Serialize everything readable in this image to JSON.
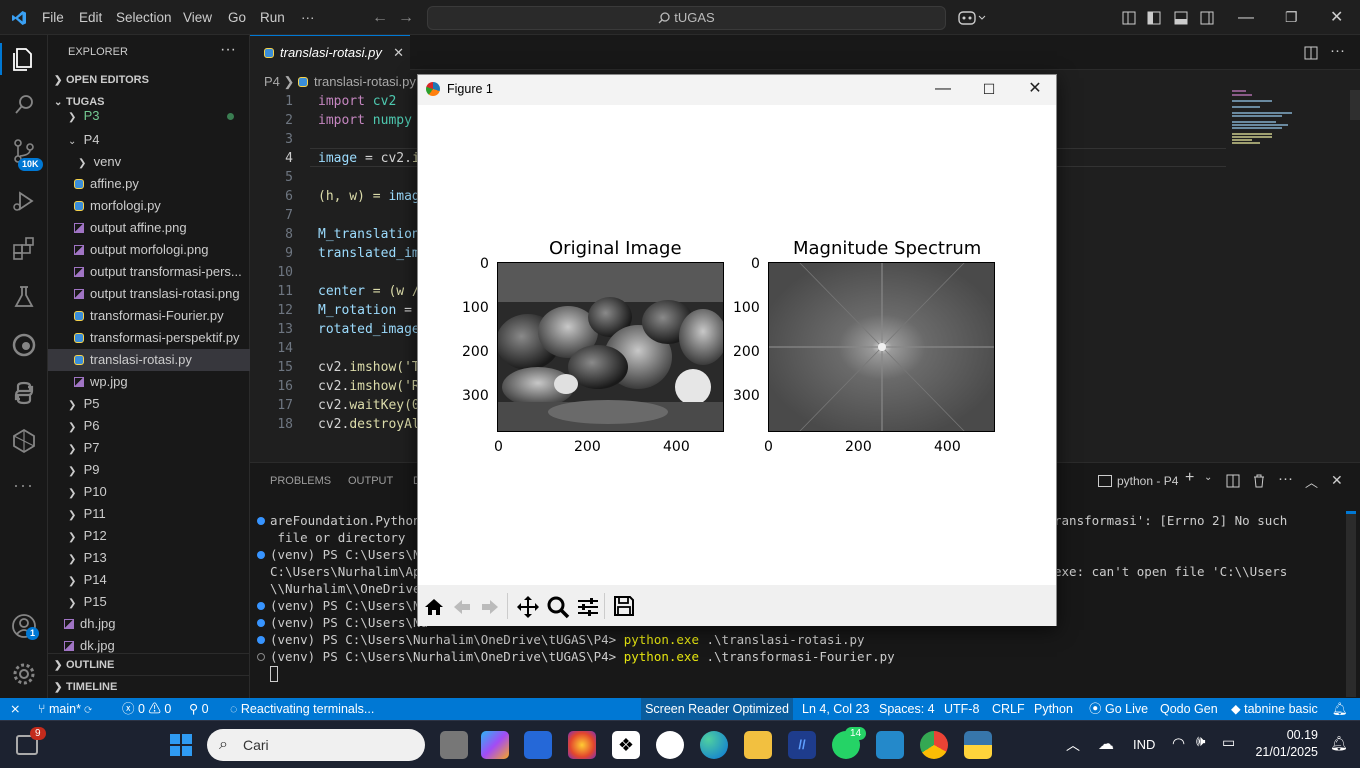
{
  "titlebar": {
    "menu": [
      "File",
      "Edit",
      "Selection",
      "View",
      "Go",
      "Run",
      "···"
    ],
    "search": "tUGAS"
  },
  "activity": {
    "source_control_badge": "10K",
    "accounts_badge": "1"
  },
  "sidebar": {
    "title": "EXPLORER",
    "open_editors": "OPEN EDITORS",
    "root": "TUGAS",
    "items": [
      {
        "label": "P3",
        "type": "folder"
      },
      {
        "label": "P4",
        "type": "folder-open"
      },
      {
        "label": "venv",
        "type": "folder"
      },
      {
        "label": "affine.py",
        "type": "py"
      },
      {
        "label": "morfologi.py",
        "type": "py"
      },
      {
        "label": "output affine.png",
        "type": "img"
      },
      {
        "label": "output morfologi.png",
        "type": "img"
      },
      {
        "label": "output transformasi-pers...",
        "type": "img"
      },
      {
        "label": "output translasi-rotasi.png",
        "type": "img"
      },
      {
        "label": "transformasi-Fourier.py",
        "type": "py"
      },
      {
        "label": "transformasi-perspektif.py",
        "type": "py"
      },
      {
        "label": "translasi-rotasi.py",
        "type": "py"
      },
      {
        "label": "wp.jpg",
        "type": "img"
      },
      {
        "label": "P5",
        "type": "folder"
      },
      {
        "label": "P6",
        "type": "folder"
      },
      {
        "label": "P7",
        "type": "folder"
      },
      {
        "label": "P9",
        "type": "folder"
      },
      {
        "label": "P10",
        "type": "folder"
      },
      {
        "label": "P11",
        "type": "folder"
      },
      {
        "label": "P12",
        "type": "folder"
      },
      {
        "label": "P13",
        "type": "folder"
      },
      {
        "label": "P14",
        "type": "folder"
      },
      {
        "label": "P15",
        "type": "folder"
      },
      {
        "label": "dh.jpg",
        "type": "img"
      },
      {
        "label": "dk.jpg",
        "type": "img"
      }
    ],
    "outline": "OUTLINE",
    "timeline": "TIMELINE"
  },
  "editor": {
    "tab": "translasi-rotasi.py",
    "breadcrumb_folder": "P4",
    "breadcrumb_file": "translasi-rotasi.py",
    "lines": [
      "1",
      "2",
      "3",
      "4",
      "5",
      "6",
      "7",
      "8",
      "9",
      "10",
      "11",
      "12",
      "13",
      "14",
      "15",
      "16",
      "17",
      "18"
    ],
    "code": {
      "l1a": "import",
      "l1b": " cv2",
      "l2a": "import",
      "l2b": " numpy",
      "l4a": "image",
      "l4b": " = cv2.",
      "l4c": "i",
      "l6a": "(h, w) = ",
      "l6b": "imag",
      "l8": "M_translation",
      "l9": "translated_im",
      "l11a": "center",
      "l11b": " = (w /",
      "l12a": "M_rotation",
      "l12b": " =",
      "l13": "rotated_image",
      "l15a": "cv2.",
      "l15b": "imshow",
      "l15c": "('T",
      "l16a": "cv2.",
      "l16b": "imshow",
      "l16c": "('R",
      "l17a": "cv2.",
      "l17b": "waitKey",
      "l17c": "(0",
      "l18a": "cv2.",
      "l18b": "destroyAl"
    }
  },
  "panel": {
    "tabs": [
      "PROBLEMS",
      "OUTPUT",
      "D"
    ],
    "terminal_name": "python - P4",
    "lines": [
      {
        "t": "areFoundation.Python.",
        "r": "ransformasi': [Errno 2] No such"
      },
      {
        "t": " file or directory",
        "r": ""
      },
      {
        "t": "(venv) PS C:\\Users\\Nu",
        "r": ""
      },
      {
        "t": "C:\\Users\\Nurhalim\\App",
        "r": "exe: can't open file 'C:\\\\Users"
      },
      {
        "t": "\\\\Nurhalim\\\\OneDrive\\",
        "r": ""
      },
      {
        "t": "(venv) PS C:\\Users\\Nu",
        "r": ""
      },
      {
        "t": "(venv) PS C:\\Users\\Nu",
        "r": ""
      }
    ],
    "prompt": "(venv) PS C:\\Users\\Nurhalim\\OneDrive\\tUGAS\\P4> ",
    "cmd1_exe": "python.exe",
    "cmd1_arg": " .\\translasi-rotasi.py",
    "cmd2_exe": "python.exe",
    "cmd2_arg": " .\\transformasi-Fourier.py"
  },
  "statusbar": {
    "branch": "main*",
    "errors": "0",
    "warnings": "0",
    "ports": "0",
    "activity": "Reactivating terminals...",
    "screen_reader": "Screen Reader Optimized",
    "position": "Ln 4, Col 23",
    "spaces": "Spaces: 4",
    "encoding": "UTF-8",
    "eol": "CRLF",
    "language": "Python",
    "golive": "Go Live",
    "qodo": "Qodo Gen",
    "tabnine": "tabnine basic"
  },
  "figure": {
    "title": "Figure 1",
    "plots": [
      {
        "title": "Original Image",
        "yticks": [
          "0",
          "100",
          "200",
          "300"
        ],
        "xticks": [
          "0",
          "200",
          "400"
        ]
      },
      {
        "title": "Magnitude Spectrum",
        "yticks": [
          "0",
          "100",
          "200",
          "300"
        ],
        "xticks": [
          "0",
          "200",
          "400"
        ]
      }
    ]
  },
  "taskbar": {
    "search": "Cari",
    "lang": "IND",
    "time": "00.19",
    "date": "21/01/2025",
    "notif_badge": "9",
    "whatsapp_badge": "14"
  },
  "colors": {
    "accent": "#0078d4",
    "statusbar": "#0078d4",
    "background": "#1f1f1f"
  }
}
